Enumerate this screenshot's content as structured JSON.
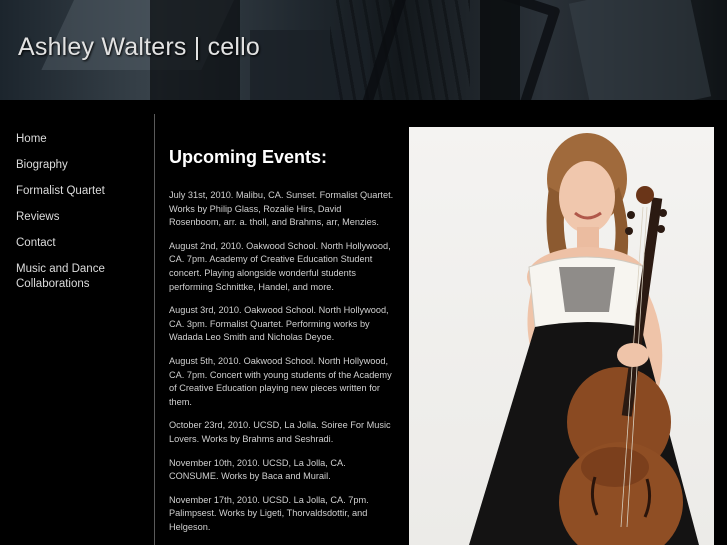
{
  "site": {
    "title": "Ashley Walters | cello"
  },
  "nav": {
    "items": [
      {
        "label": "Home"
      },
      {
        "label": "Biography"
      },
      {
        "label": "Formalist Quartet"
      },
      {
        "label": "Reviews"
      },
      {
        "label": "Contact"
      },
      {
        "label": "Music and Dance Collaborations"
      }
    ]
  },
  "main": {
    "heading": "Upcoming Events:",
    "events": [
      {
        "text": "July 31st, 2010. Malibu, CA. Sunset. Formalist Quartet. Works by Philip Glass, Rozalie Hirs, David Rosenboom, arr. a. tholl, and Brahms, arr, Menzies."
      },
      {
        "text": "August 2nd, 2010. Oakwood School. North Hollywood, CA.  7pm. Academy of Creative Education Student concert.  Playing alongside wonderful students performing Schnittke, Handel, and more."
      },
      {
        "text": "August 3rd, 2010. Oakwood School. North Hollywood, CA. 3pm. Formalist Quartet. Performing works by Wadada Leo Smith and Nicholas Deyoe."
      },
      {
        "text": "August 5th, 2010. Oakwood School. North Hollywood, CA. 7pm. Concert with young students of the Academy of Creative Education playing new pieces written for them."
      },
      {
        "text": "October 23rd, 2010. UCSD, La Jolla. Soiree For Music Lovers. Works by Brahms and Seshradi."
      },
      {
        "text": "November 10th, 2010. UCSD, La Jolla, CA. CONSUME. Works by Baca and Murail."
      },
      {
        "text": "November 17th, 2010. UCSD. La Jolla, CA. 7pm. Palimpsest. Works by Ligeti, Thorvaldsdottir, and Helgeson."
      }
    ]
  },
  "colors": {
    "background": "#000000",
    "text": "#dddddd",
    "heading": "#ffffff"
  }
}
